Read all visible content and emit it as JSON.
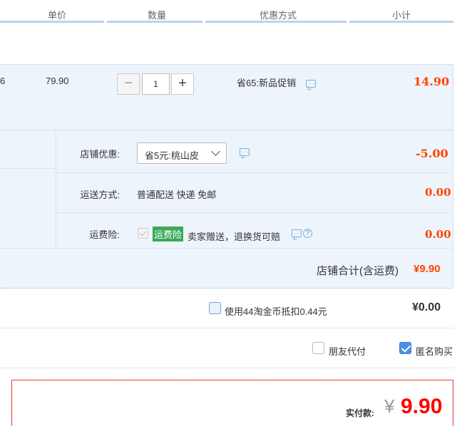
{
  "header": {
    "col_unit_price": "单价",
    "col_quantity": "数量",
    "col_discount": "优惠方式",
    "col_subtotal": "小计"
  },
  "item": {
    "left_fragment": "6",
    "unit_price": "79.90",
    "qty_minus": "−",
    "qty_value": "1",
    "qty_plus": "+",
    "discount_text": "省65:新品促销",
    "subtotal": "14.90"
  },
  "store": {
    "coupon_label": "店铺优惠:",
    "coupon_selected": "省5元:桃山皮",
    "coupon_value": "-5.00",
    "shipping_label": "运送方式:",
    "shipping_text": "普通配送 快递 免邮",
    "shipping_value": "0.00",
    "insurance_label": "运费险:",
    "insurance_tag": "运费险",
    "insurance_text": "卖家赠送，退换货可赔",
    "insurance_value": "0.00",
    "total_label": "店铺合计(含运费)",
    "total_value": "¥9.90"
  },
  "coins": {
    "text": "使用44淘金币抵扣0.44元",
    "value": "¥0.00"
  },
  "options": {
    "friend_pay": "朋友代付",
    "anonymous": "匿名购买",
    "anonymous_checked": true
  },
  "pay": {
    "label": "实付款:",
    "yen": "¥",
    "value": "9.90"
  },
  "colors": {
    "price_red": "#ff4400",
    "pay_red": "#ff0000",
    "row_bg": "#eef4fb",
    "insurance_green": "#3aa858",
    "checkbox_blue": "#4d8fe6"
  }
}
